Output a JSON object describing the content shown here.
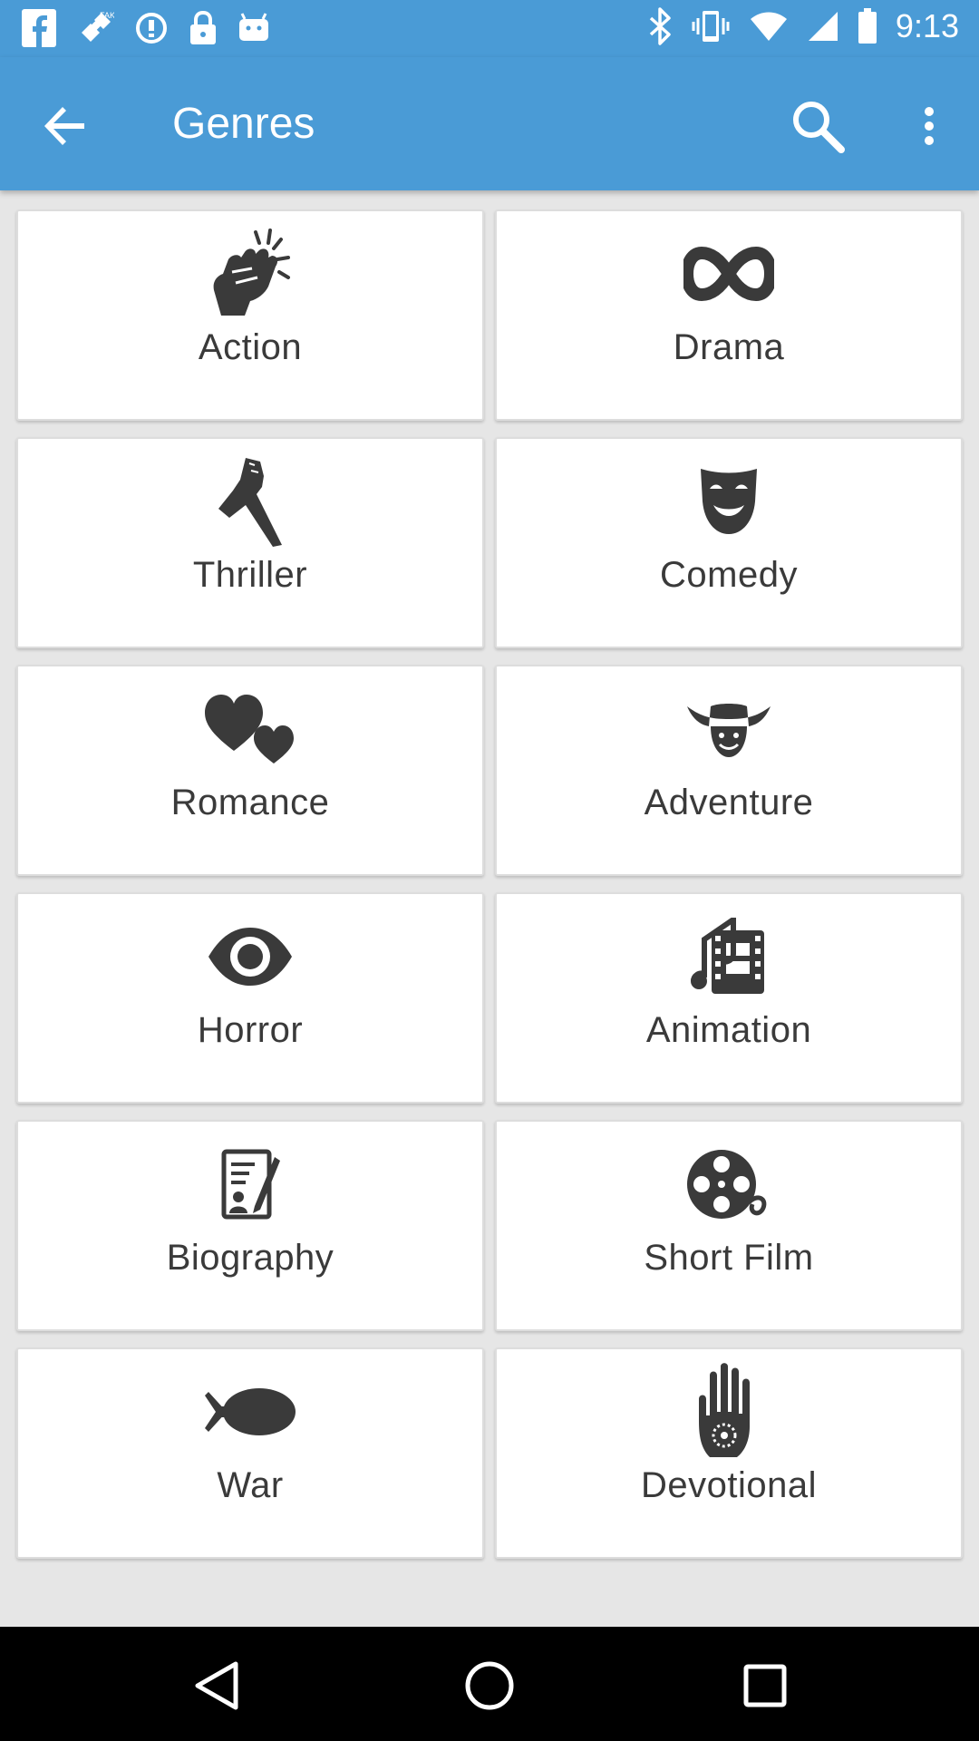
{
  "status_bar": {
    "time": "9:13",
    "left_icons": [
      "facebook-icon",
      "satellite-icon",
      "data-saver-icon",
      "lock-icon",
      "android-icon"
    ],
    "right_icons": [
      "bluetooth-icon",
      "vibrate-icon",
      "wifi-icon",
      "signal-icon",
      "battery-icon"
    ]
  },
  "app_bar": {
    "title": "Genres",
    "back_icon": "arrow-back-icon",
    "search_icon": "search-icon",
    "more_icon": "more-vert-icon"
  },
  "genres": [
    {
      "label": "Action",
      "icon": "fist-icon"
    },
    {
      "label": "Drama",
      "icon": "infinity-icon"
    },
    {
      "label": "Thriller",
      "icon": "knife-hand-icon"
    },
    {
      "label": "Comedy",
      "icon": "mask-icon"
    },
    {
      "label": "Romance",
      "icon": "hearts-icon"
    },
    {
      "label": "Adventure",
      "icon": "cowboy-icon"
    },
    {
      "label": "Horror",
      "icon": "eye-icon"
    },
    {
      "label": "Animation",
      "icon": "film-music-icon"
    },
    {
      "label": "Biography",
      "icon": "document-pen-icon"
    },
    {
      "label": "Short Film",
      "icon": "film-reel-icon"
    },
    {
      "label": "War",
      "icon": "bomb-icon"
    },
    {
      "label": "Devotional",
      "icon": "hamsa-hand-icon"
    }
  ],
  "nav_bar": {
    "back": "nav-back-icon",
    "home": "nav-home-icon",
    "recents": "nav-recents-icon"
  },
  "colors": {
    "app_bar": "#4a9bd6",
    "background": "#e6e6e6",
    "card": "#ffffff",
    "icon": "#3a3a3a",
    "nav_bar": "#000000"
  }
}
